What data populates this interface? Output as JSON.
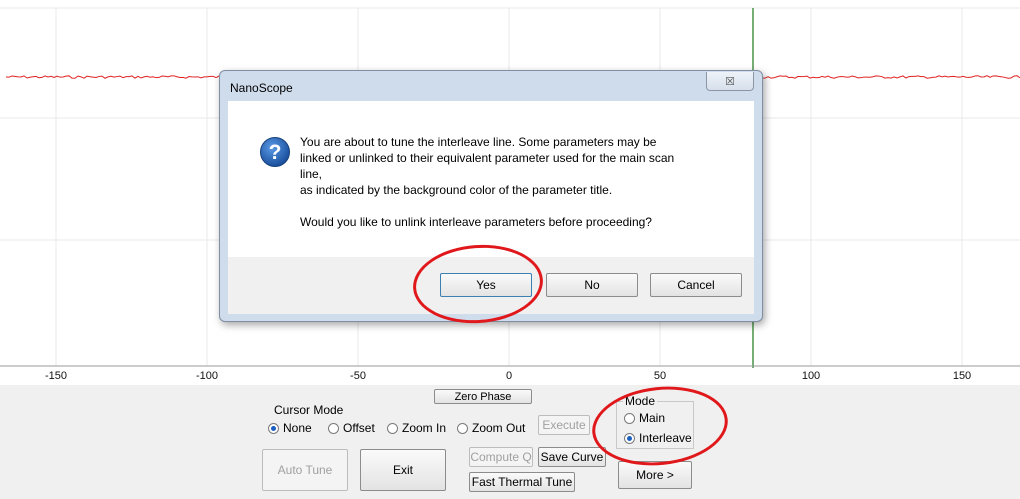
{
  "plot": {
    "x_ticks": [
      "-150",
      "-100",
      "-50",
      "0",
      "50",
      "100",
      "150"
    ],
    "line_color": "#e02020",
    "cursor_color": "#1a7a1a",
    "grid_color": "#e8e8e8"
  },
  "controls": {
    "zero_phase_label": "Zero Phase",
    "cursor_mode": {
      "title": "Cursor Mode",
      "options": [
        "None",
        "Offset",
        "Zoom In",
        "Zoom Out"
      ],
      "selected": "None"
    },
    "execute_label": "Execute",
    "mode": {
      "title": "Mode",
      "options": [
        "Main",
        "Interleave"
      ],
      "selected": "Interleave"
    },
    "auto_tune_label": "Auto Tune",
    "exit_label": "Exit",
    "compute_q_label": "Compute Q",
    "save_curve_label": "Save Curve",
    "fast_thermal_tune_label": "Fast Thermal Tune",
    "more_label": "More >"
  },
  "dialog": {
    "title": "NanoScope",
    "close_glyph": "☒",
    "message_lines": [
      "You are about to tune the interleave line. Some parameters may be",
      "linked or unlinked to their equivalent parameter used for the main scan",
      "line,",
      "as indicated by the background color of the parameter title.",
      "Would you like to unlink interleave parameters before proceeding?"
    ],
    "yes_label": "Yes",
    "no_label": "No",
    "cancel_label": "Cancel"
  },
  "annotation_color": "#e0181b"
}
